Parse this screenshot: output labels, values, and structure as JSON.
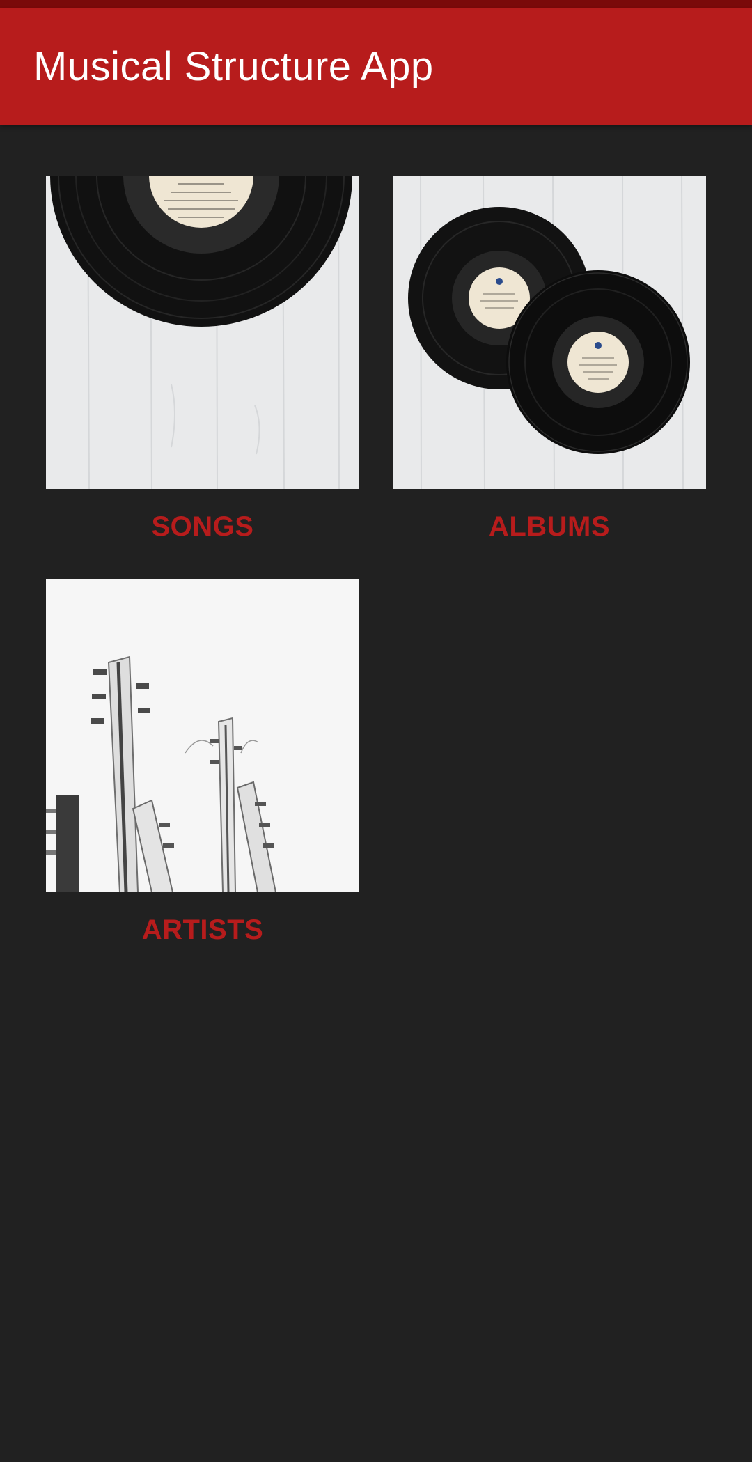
{
  "app": {
    "title": "Musical Structure App"
  },
  "colors": {
    "primary": "#b71c1c",
    "primary_dark": "#7a0a0a",
    "background": "#212121",
    "label": "#b71c1c"
  },
  "categories": [
    {
      "id": "songs",
      "label": "SONGS",
      "image": "single-vinyl-record-on-wood"
    },
    {
      "id": "albums",
      "label": "ALBUMS",
      "image": "two-vinyl-records-on-wood"
    },
    {
      "id": "artists",
      "label": "ARTISTS",
      "image": "guitar-headstocks-white"
    }
  ]
}
